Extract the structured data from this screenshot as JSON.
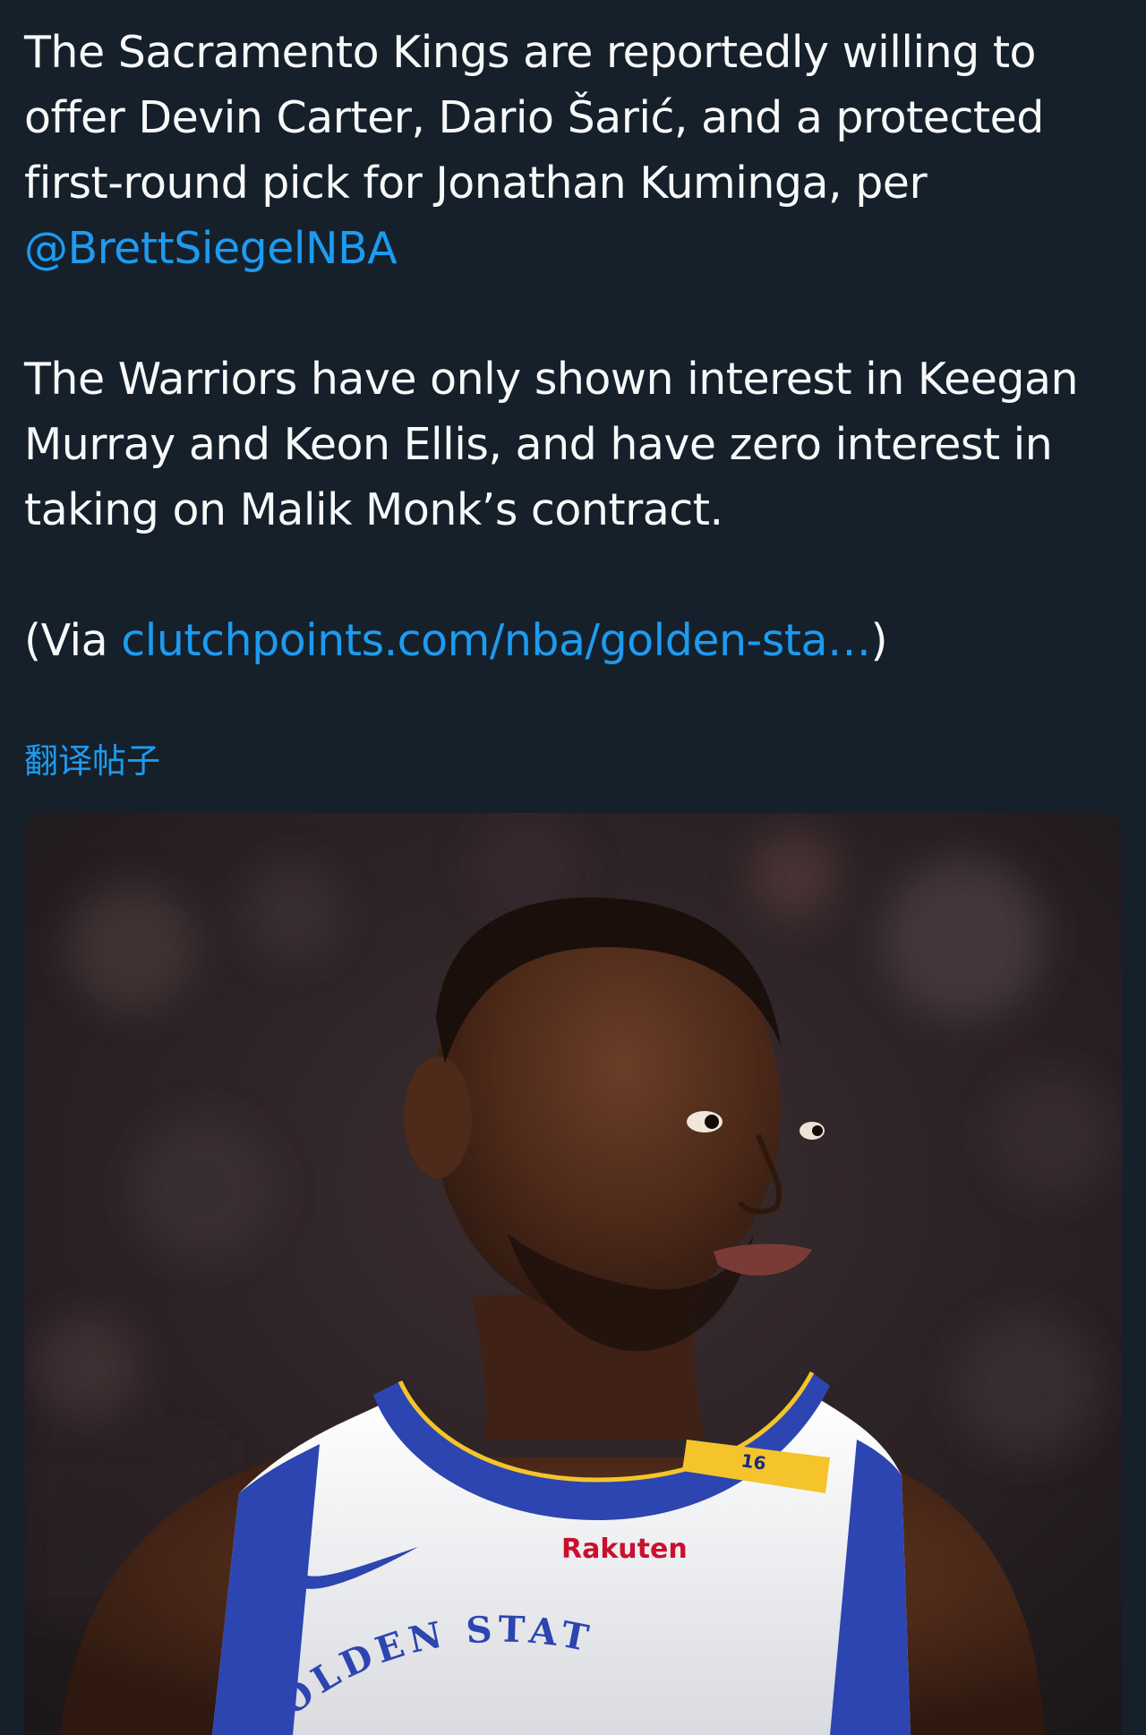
{
  "tweet": {
    "p1_text": "The Sacramento Kings are reportedly willing to offer Devin Carter, Dario Šarić, and a protected first-round pick for Jonathan Kuminga, per",
    "p1_mention": "@BrettSiegelNBA",
    "p2_text": "The Warriors have only shown interest in Keegan Murray and Keon Ellis, and have zero interest in taking on Malik Monk’s contract.",
    "p3_prefix": "(Via",
    "p3_link": "clutchpoints.com/nba/golden-sta…",
    "p3_suffix": ")",
    "translate_label": "翻译帖子"
  },
  "media": {
    "jersey_number": "16",
    "sponsor": "Rakuten",
    "jersey_lettering": "OLDEN STAT"
  },
  "colors": {
    "background": "#15202b",
    "text": "#f7f9f9",
    "link": "#1d9bf0",
    "jersey_blue": "#2c45b0",
    "jersey_gold": "#f5c42c",
    "sponsor_red": "#c9102f"
  }
}
